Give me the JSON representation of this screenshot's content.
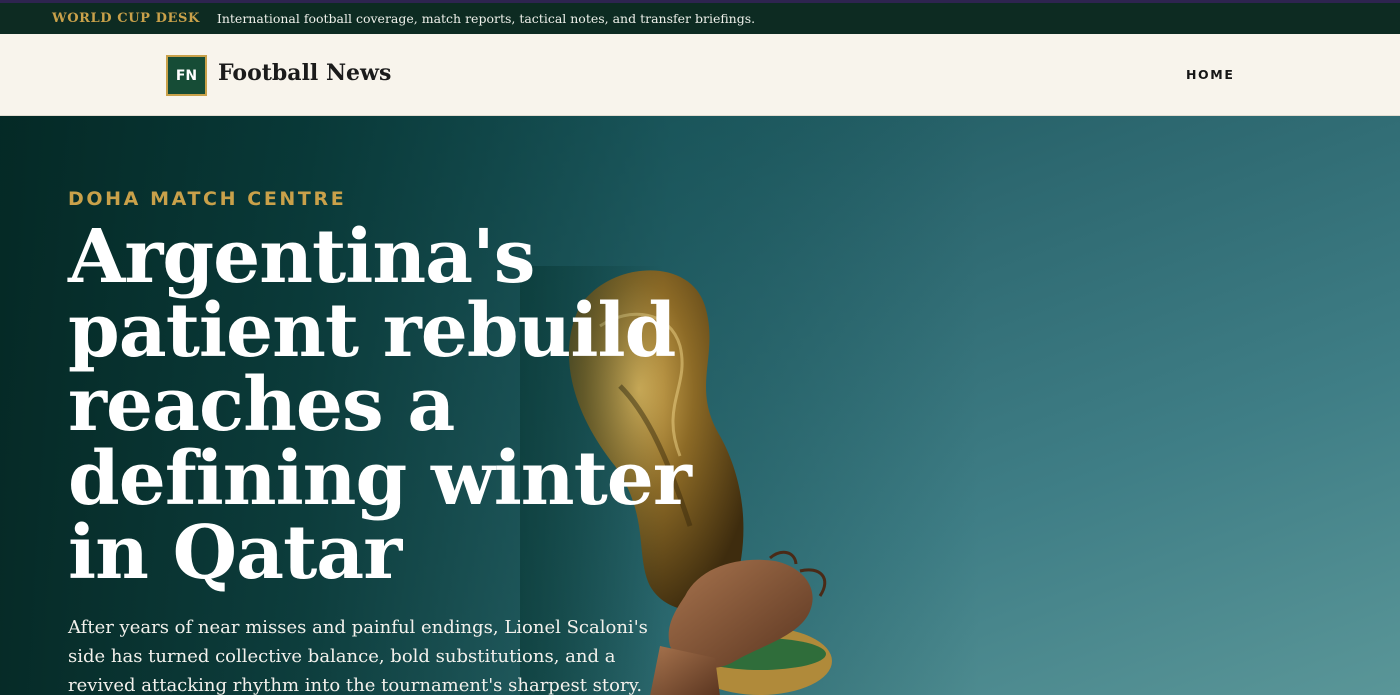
{
  "topbar": {
    "desk_label": "WORLD CUP DESK",
    "tagline": "International football coverage, match reports, tactical notes, and transfer briefings."
  },
  "header": {
    "logo_text": "FN",
    "site_name": "Football News",
    "nav": {
      "home": "HOME"
    }
  },
  "hero": {
    "kicker": "DOHA MATCH CENTRE",
    "headline": "Argentina's patient rebuild reaches a defining winter in Qatar",
    "dek": "After years of near misses and painful endings, Lionel Scaloni's side has turned collective balance, bold substitutions, and a revived attacking rhythm into the tournament's sharpest story.",
    "image_icon": "trophy-photo"
  },
  "colors": {
    "accent_gold": "#c9a14a",
    "topbar_bg": "#0d2b22",
    "header_bg": "#f8f4ec",
    "logo_bg": "#164c36",
    "hero_teal": "#2d6870"
  }
}
